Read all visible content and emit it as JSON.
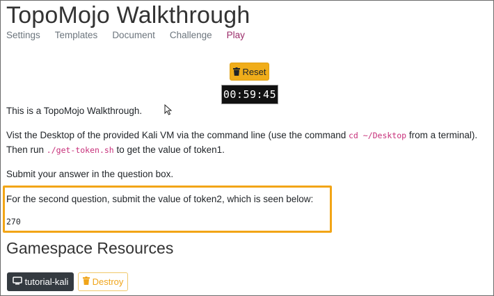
{
  "header": {
    "title": "TopoMojo Walkthrough",
    "tabs": [
      {
        "label": "Settings"
      },
      {
        "label": "Templates"
      },
      {
        "label": "Document"
      },
      {
        "label": "Challenge"
      },
      {
        "label": "Play"
      }
    ],
    "active_tab": "Play"
  },
  "controls": {
    "reset_label": "Reset",
    "timer": "00:59:45"
  },
  "content": {
    "p1": "This is a TopoMojo Walkthrough.",
    "p2_before": "Vist the Desktop of the provided Kali VM via the command line (use the command ",
    "p2_code": "cd ~/Desktop",
    "p2_after": " from a terminal).",
    "p3_before": "Then run ",
    "p3_code": "./get-token.sh",
    "p3_after": " to get the value of token1.",
    "p4": "Submit your answer in the question box.",
    "p5": "For the second question, submit the value of token2, which is seen below:",
    "token_value": "270"
  },
  "resources": {
    "title": "Gamespace Resources",
    "vm_label": "tutorial-kali",
    "destroy_label": "Destroy"
  },
  "colors": {
    "accent_orange": "#f0ad1a",
    "active_tab": "#9b2c6a",
    "code_pink": "#c7307a",
    "dark_button": "#343a40"
  },
  "icons": [
    "trash-icon",
    "monitor-icon",
    "mouse-pointer-icon"
  ]
}
